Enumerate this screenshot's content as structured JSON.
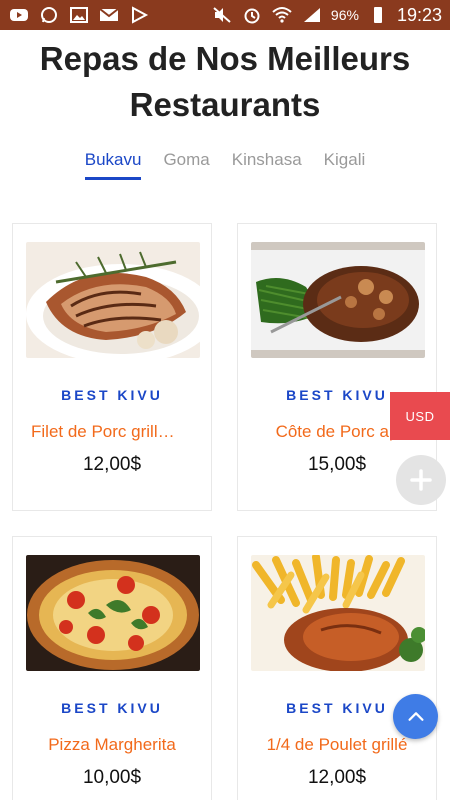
{
  "status_bar": {
    "icons_left": [
      "youtube-icon",
      "whatsapp-icon",
      "gallery-icon",
      "gmail-icon",
      "play-store-icon"
    ],
    "icons_right": [
      "mute-icon",
      "alarm-icon",
      "wifi-icon",
      "signal-icon",
      "battery-icon"
    ],
    "battery": "96%",
    "time": "19:23"
  },
  "page": {
    "title_line1": "Repas de Nos Meilleurs",
    "title_line2": "Restaurants"
  },
  "tabs": [
    {
      "label": "Bukavu",
      "active": true
    },
    {
      "label": "Goma",
      "active": false
    },
    {
      "label": "Kinshasa",
      "active": false
    },
    {
      "label": "Kigali",
      "active": false
    }
  ],
  "products": [
    {
      "brand": "BEST KIVU",
      "name": "Filet de Porc grill…",
      "price": "12,00$",
      "image": "grilled-pork-fillet-image"
    },
    {
      "brand": "BEST KIVU",
      "name": "Côte de Porc ap",
      "price": "15,00$",
      "image": "pork-chop-image"
    },
    {
      "brand": "BEST KIVU",
      "name": "Pizza Margherita",
      "price": "10,00$",
      "image": "pizza-image"
    },
    {
      "brand": "BEST KIVU",
      "name": "1/4 de Poulet grillé",
      "price": "12,00$",
      "image": "chicken-fries-image"
    }
  ],
  "widgets": {
    "currency_label": "USD",
    "add_icon": "plus-icon",
    "scroll_top_icon": "chevron-up-icon"
  },
  "colors": {
    "status_bar": "#8a3a1e",
    "accent_blue": "#1b47c7",
    "product_name": "#f26a1b",
    "currency_tab": "#e94a4f",
    "scroll_top_fab": "#3f7ce6"
  }
}
